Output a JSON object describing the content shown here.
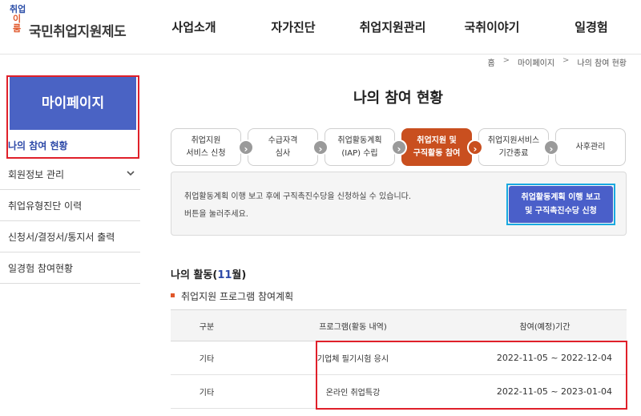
{
  "logo": {
    "small_line1": "취업",
    "small_line2": "이룸",
    "title": "국민취업지원제도"
  },
  "gnb": [
    "사업소개",
    "자가진단",
    "취업지원관리",
    "국취이야기",
    "일경험"
  ],
  "breadcrumb": [
    "홈",
    "마이페이지",
    "나의 참여 현황"
  ],
  "sidebar": {
    "title": "마이페이지",
    "active": "나의 참여 현황",
    "items": [
      {
        "label": "회원정보 관리",
        "icon": "chevron-down-icon"
      },
      {
        "label": "취업유형진단 이력"
      },
      {
        "label": "신청서/결정서/통지서 출력"
      },
      {
        "label": "일경험 참여현황"
      }
    ]
  },
  "page_title": "나의 참여 현황",
  "steps": [
    {
      "line1": "취업지원",
      "line2": "서비스 신청"
    },
    {
      "line1": "수급자격",
      "line2": "심사"
    },
    {
      "line1": "취업활동계획",
      "line2": "(IAP) 수립"
    },
    {
      "line1": "취업지원 및",
      "line2": "구직활동 참여",
      "active": true
    },
    {
      "line1": "취업지원서비스",
      "line2": "기간종료"
    },
    {
      "line1": "사후관리",
      "line2": ""
    }
  ],
  "notice": {
    "line1": "취업활동계획 이행 보고 후에 구직촉진수당을 신청하실 수 있습니다.",
    "line2": "버튼을 눌러주세요.",
    "button_line1": "취업활동계획 이행 보고",
    "button_line2": "및 구직촉진수당 신청"
  },
  "activity": {
    "title_prefix": "나의 활동(",
    "month": "11",
    "title_suffix": "월)",
    "subtitle": "취업지원 프로그램 참여계획"
  },
  "table": {
    "headers": [
      "구분",
      "프로그램(활동 내역)",
      "참여(예정)기간"
    ],
    "rows": [
      [
        "기타",
        "기업체 필기시험 응시",
        "2022-11-05 ~ 2022-12-04"
      ],
      [
        "기타",
        "온라인 취업특강",
        "2022-11-05 ~ 2023-01-04"
      ]
    ]
  },
  "colors": {
    "brand_blue": "#4a63c4",
    "active_step": "#c94f1f",
    "highlight_red": "#e0202a",
    "highlight_cyan": "#19a9e0"
  }
}
